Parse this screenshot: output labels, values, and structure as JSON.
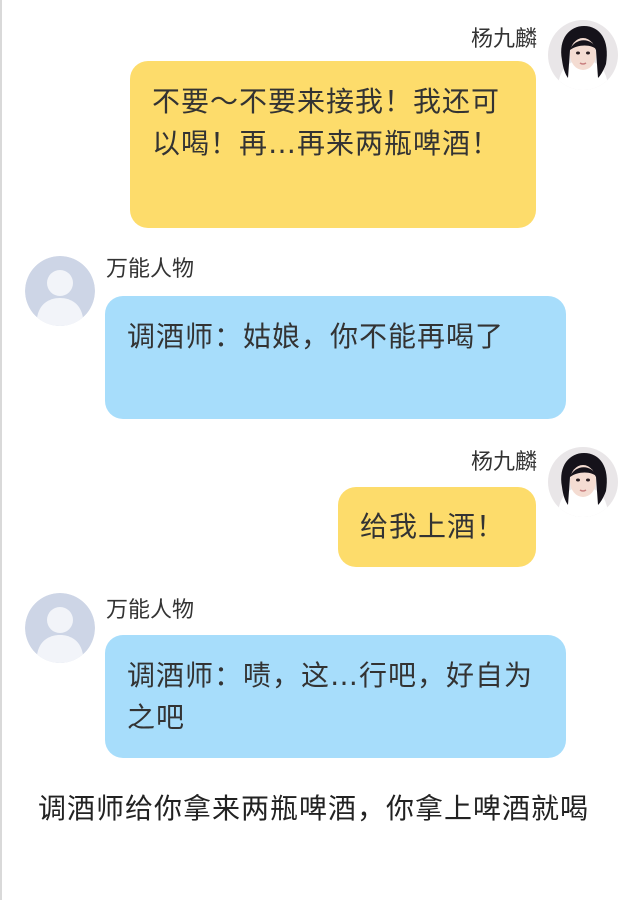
{
  "messages": [
    {
      "role": "user",
      "name": "杨九麟",
      "avatar": "profile-photo",
      "text": "不要～不要来接我！我还可以喝！再…再来两瓶啤酒！"
    },
    {
      "role": "bot",
      "name": "万能人物",
      "avatar": "default-person-icon",
      "text": "调酒师：姑娘，你不能再喝了"
    },
    {
      "role": "user",
      "name": "杨九麟",
      "avatar": "profile-photo",
      "text": "给我上酒！"
    },
    {
      "role": "bot",
      "name": "万能人物",
      "avatar": "default-person-icon",
      "text": "调酒师：啧，这…行吧，好自为之吧"
    }
  ],
  "narration": "调酒师给你拿来两瓶啤酒，你拿上啤酒就喝",
  "colors": {
    "user_bubble": "#fddc6b",
    "bot_bubble": "#a7ddfb",
    "default_avatar_bg": "#cdd5e6",
    "default_avatar_fg": "#f2f4f9"
  }
}
